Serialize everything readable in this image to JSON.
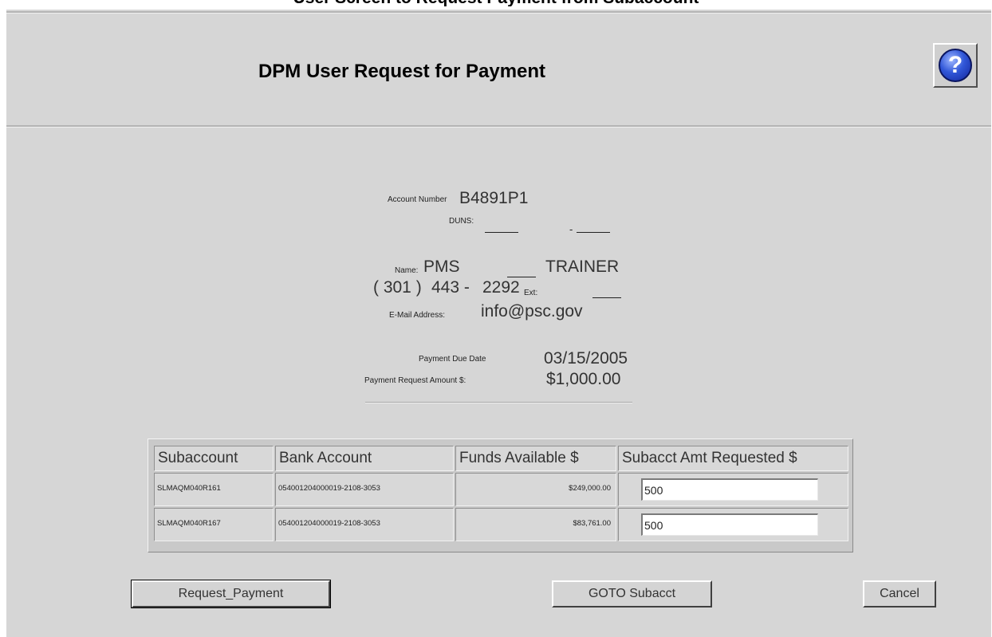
{
  "top_caption": "User Screen to Request Payment from Subaccount",
  "header": {
    "title": "DPM User Request for Payment",
    "help_glyph": "?"
  },
  "account": {
    "number_label": "Account Number",
    "number": "B4891P1",
    "duns_label": "DUNS:",
    "duns_separator": "-"
  },
  "contact": {
    "name_label": "Name:",
    "first_name": "PMS",
    "last_name": "TRAINER",
    "phone_area": "( 301 )",
    "phone_prefix": "443 -",
    "phone_line": "2292",
    "ext_label": "Ext:",
    "email_label": "E-Mail Address:",
    "email": "info@psc.gov"
  },
  "payment": {
    "due_date_label": "Payment Due Date",
    "due_date": "03/15/2005",
    "amount_label": "Payment Request Amount $:",
    "amount": "$1,000.00"
  },
  "table": {
    "headers": [
      "Subaccount",
      "Bank Account",
      "Funds Available $",
      "Subacct Amt Requested $"
    ],
    "rows": [
      {
        "subaccount": "SLMAQM040R161",
        "bank_account": "054001204000019-2108-3053",
        "funds_available": "$249,000.00",
        "amount_requested": "500"
      },
      {
        "subaccount": "SLMAQM040R167",
        "bank_account": "054001204000019-2108-3053",
        "funds_available": "$83,761.00",
        "amount_requested": "500"
      }
    ]
  },
  "buttons": {
    "request_payment": "Request_Payment",
    "goto_subacct": "GOTO Subacct",
    "cancel": "Cancel"
  },
  "colors": {
    "panel_background": "#d6d6d6",
    "help_icon": "#2a4fd0"
  },
  "icons": [
    "help-icon"
  ]
}
